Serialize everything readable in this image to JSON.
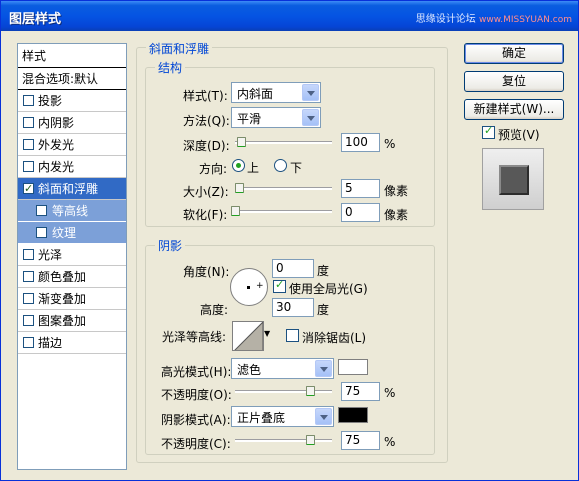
{
  "window": {
    "title": "图层样式",
    "watermark": "思缘设计论坛",
    "watermark_url": "www.MISSYUAN.com"
  },
  "stylelist": {
    "header": "样式",
    "blend": "混合选项:默认",
    "items": [
      {
        "label": "投影",
        "checked": false
      },
      {
        "label": "内阴影",
        "checked": false
      },
      {
        "label": "外发光",
        "checked": false
      },
      {
        "label": "内发光",
        "checked": false
      },
      {
        "label": "斜面和浮雕",
        "checked": true
      },
      {
        "label": "等高线",
        "checked": false
      },
      {
        "label": "纹理",
        "checked": false
      },
      {
        "label": "光泽",
        "checked": false
      },
      {
        "label": "颜色叠加",
        "checked": false
      },
      {
        "label": "渐变叠加",
        "checked": false
      },
      {
        "label": "图案叠加",
        "checked": false
      },
      {
        "label": "描边",
        "checked": false
      }
    ]
  },
  "bevel": {
    "group_title": "斜面和浮雕",
    "structure_title": "结构",
    "style_label": "样式(T):",
    "style_value": "内斜面",
    "technique_label": "方法(Q):",
    "technique_value": "平滑",
    "depth_label": "深度(D):",
    "depth_value": "100",
    "depth_unit": "%",
    "direction_label": "方向:",
    "direction_up": "上",
    "direction_down": "下",
    "size_label": "大小(Z):",
    "size_value": "5",
    "size_unit": "像素",
    "soften_label": "软化(F):",
    "soften_value": "0",
    "soften_unit": "像素"
  },
  "shading": {
    "title": "阴影",
    "angle_label": "角度(N):",
    "angle_value": "0",
    "angle_unit": "度",
    "global_light_label": "使用全局光(G)",
    "altitude_label": "高度:",
    "altitude_value": "30",
    "altitude_unit": "度",
    "gloss_label": "光泽等高线:",
    "antialias_label": "消除锯齿(L)",
    "highlight_mode_label": "高光模式(H):",
    "highlight_mode_value": "滤色",
    "highlight_color": "#ffffff",
    "highlight_opacity_label": "不透明度(O):",
    "highlight_opacity_value": "75",
    "opacity_unit": "%",
    "shadow_mode_label": "阴影模式(A):",
    "shadow_mode_value": "正片叠底",
    "shadow_color": "#000000",
    "shadow_opacity_label": "不透明度(C):",
    "shadow_opacity_value": "75"
  },
  "buttons": {
    "ok": "确定",
    "reset": "复位",
    "new_style": "新建样式(W)...",
    "preview_label": "预览(V)"
  }
}
